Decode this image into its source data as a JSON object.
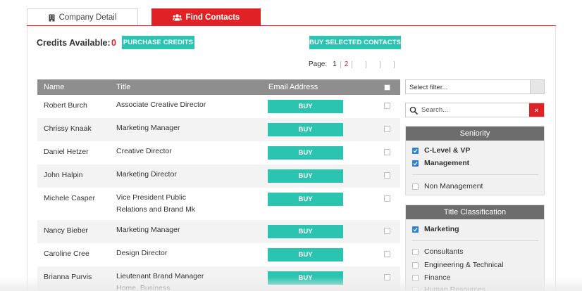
{
  "tabs": {
    "company_detail": "Company Detail",
    "find_contacts": "Find Contacts"
  },
  "header": {
    "credits_label": "Credits Available:",
    "credits_value": "0",
    "purchase_label": "PURCHASE CREDITS",
    "buy_selected_label": "BUY SELECTED CONTACTS"
  },
  "pager": {
    "label": "Page:",
    "page1": "1",
    "page2": "2",
    "current": "2"
  },
  "table": {
    "columns": {
      "name": "Name",
      "title": "Title",
      "email": "Email Address"
    },
    "buy_label": "BUY",
    "rows": [
      {
        "name": "Robert Burch",
        "title": "Associate Creative Director"
      },
      {
        "name": "Chrissy Knaak",
        "title": "Marketing Manager"
      },
      {
        "name": "Daniel Hetzer",
        "title": "Creative Director"
      },
      {
        "name": "John Halpin",
        "title": "Marketing Director"
      },
      {
        "name": "Michele Casper",
        "title": "Vice President Public Relations and Brand Mk"
      },
      {
        "name": "Nancy Bieber",
        "title": "Marketing Manager"
      },
      {
        "name": "Caroline Cree",
        "title": "Design Director"
      },
      {
        "name": "Brianna Purvis",
        "title": "Lieutenant Brand Manager Home, Business"
      }
    ]
  },
  "sidebar": {
    "filter_placeholder": "Select filter...",
    "search_placeholder": "Search...",
    "clear_label": "×",
    "seniority": {
      "heading": "Seniority",
      "options": [
        {
          "label": "C-Level & VP",
          "checked": true
        },
        {
          "label": "Management",
          "checked": true
        },
        {
          "label": "Non Management",
          "checked": false
        }
      ]
    },
    "title_classification": {
      "heading": "Title Classification",
      "options": [
        {
          "label": "Marketing",
          "checked": true
        },
        {
          "label": "Consultants",
          "checked": false
        },
        {
          "label": "Engineering & Technical",
          "checked": false
        },
        {
          "label": "Finance",
          "checked": false
        },
        {
          "label": "Human Resources",
          "checked": false
        }
      ]
    }
  },
  "colors": {
    "brand_red": "#e02226",
    "teal": "#2bc4b0",
    "header_gray": "#8e8e8e",
    "panel_head": "#6d6d6d",
    "check_blue": "#2f80d1"
  },
  "icons": {
    "company_tab": "building-icon",
    "find_tab": "users-icon",
    "search": "search-icon",
    "clear": "close-icon"
  }
}
